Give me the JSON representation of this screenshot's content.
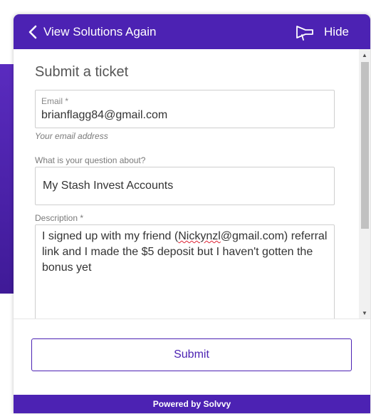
{
  "header": {
    "back_label": "View Solutions Again",
    "hide_label": "Hide"
  },
  "form": {
    "title": "Submit a ticket",
    "email": {
      "label": "Email *",
      "value": "brianflagg84@gmail.com",
      "helper": "Your email address"
    },
    "question": {
      "label": "What is your question about?",
      "value": "My Stash Invest Accounts"
    },
    "description": {
      "label": "Description *",
      "value_pre": "I signed up with my friend (",
      "value_misspelled": "Nickynzl",
      "value_post": "@gmail.com) referral link and I made the $5 deposit but I haven't gotten the bonus yet"
    }
  },
  "footer": {
    "submit_label": "Submit",
    "powered_by": "Powered by Solvvy"
  },
  "colors": {
    "brand": "#4c22b3",
    "text": "#333333",
    "muted": "#7a7a7a"
  },
  "icons": {
    "back": "chevron-left-icon",
    "hide": "megaphone-icon",
    "scroll_up": "arrow-up-icon",
    "scroll_down": "arrow-down-icon"
  }
}
